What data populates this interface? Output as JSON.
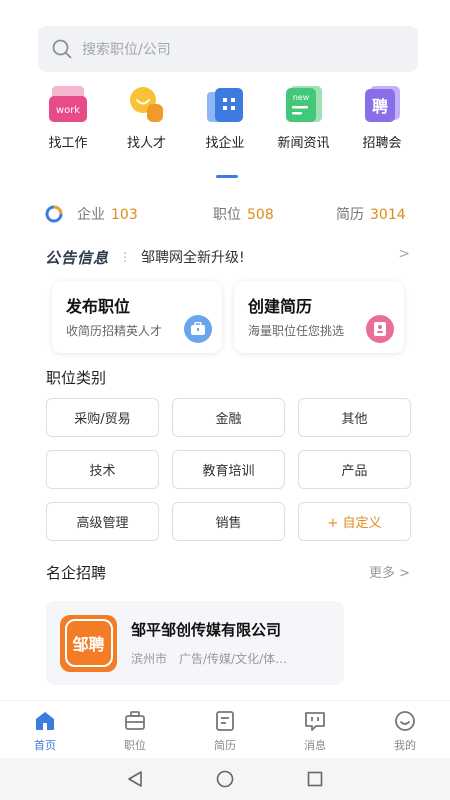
{
  "search": {
    "placeholder": "搜索职位/公司",
    "icon": "search-icon"
  },
  "quick_nav": [
    {
      "label": "找工作",
      "icon": "work-folder-icon",
      "badge": "work"
    },
    {
      "label": "找人才",
      "icon": "person-icon"
    },
    {
      "label": "找企业",
      "icon": "building-icon"
    },
    {
      "label": "新闻资讯",
      "icon": "news-icon",
      "badge": "new"
    },
    {
      "label": "招聘会",
      "icon": "job-fair-icon",
      "badge": "聘"
    }
  ],
  "stats": [
    {
      "label": "企业",
      "value": "103"
    },
    {
      "label": "职位",
      "value": "508"
    },
    {
      "label": "简历",
      "value": "3014"
    }
  ],
  "notice": {
    "brand": "公告信息",
    "text": "邹聘网全新升级!"
  },
  "cards": [
    {
      "title": "发布职位",
      "subtitle": "收简历招精英人才",
      "icon": "briefcase-icon"
    },
    {
      "title": "创建简历",
      "subtitle": "海量职位任您挑选",
      "icon": "resume-icon"
    }
  ],
  "categories_title": "职位类别",
  "categories": [
    "采购/贸易",
    "金融",
    "其他",
    "技术",
    "教育培训",
    "产品",
    "高级管理",
    "销售",
    "+ 自定义"
  ],
  "featured": {
    "title": "名企招聘",
    "more": "更多 >",
    "companies": [
      {
        "logo_text": "邹聘",
        "name": "邹平邹创传媒有限公司",
        "city": "滨州市",
        "industry": "广告/传媒/文化/体…"
      }
    ]
  },
  "tabbar": [
    {
      "label": "首页",
      "icon": "home-icon",
      "active": true
    },
    {
      "label": "职位",
      "icon": "briefcase-icon"
    },
    {
      "label": "简历",
      "icon": "resume-icon"
    },
    {
      "label": "消息",
      "icon": "message-icon"
    },
    {
      "label": "我的",
      "icon": "profile-icon"
    }
  ],
  "colors": {
    "accent": "#3e7be0",
    "number": "#e08a1c",
    "company_logo": "#f37c26"
  }
}
